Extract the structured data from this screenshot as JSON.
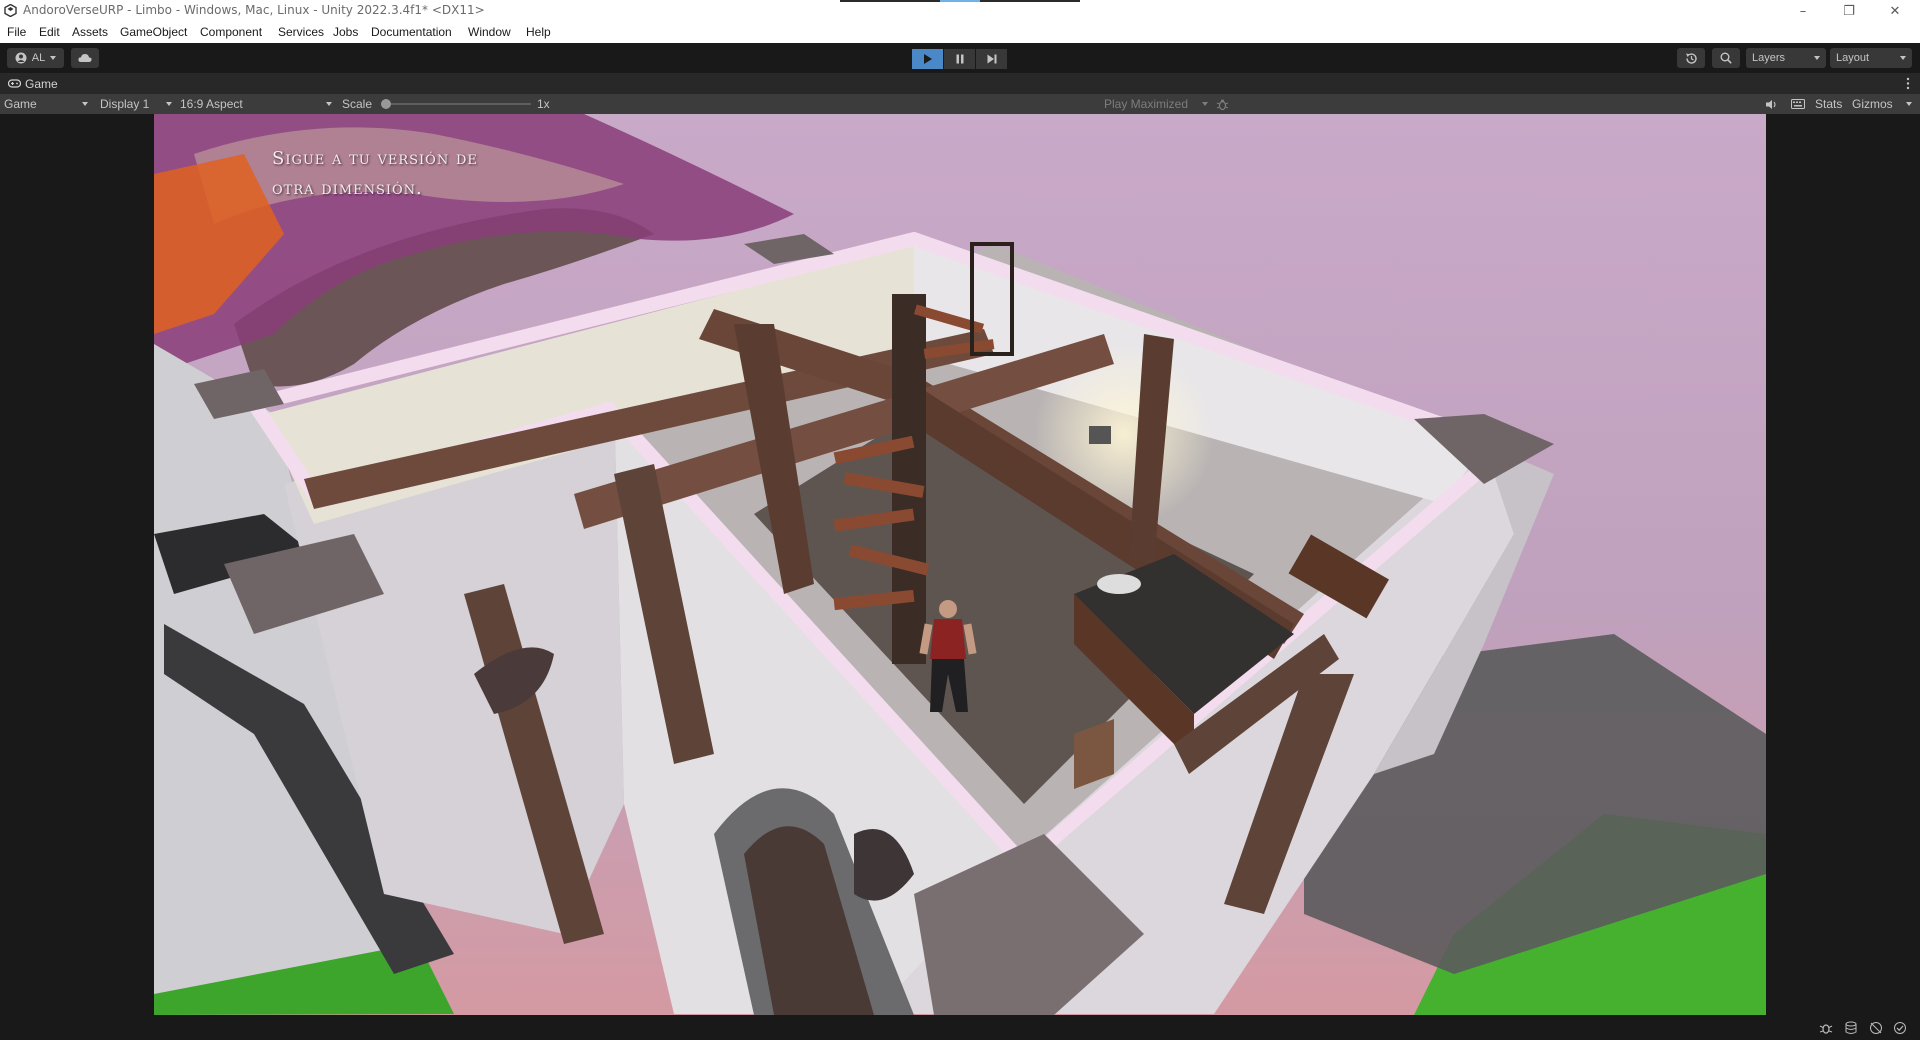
{
  "window": {
    "title": "AndoroVerseURP - Limbo - Windows, Mac, Linux - Unity 2022.3.4f1* <DX11>",
    "minimize": "–",
    "restore": "❐",
    "close": "✕"
  },
  "menu": {
    "items": [
      "File",
      "Edit",
      "Assets",
      "GameObject",
      "Component",
      "Services",
      "Jobs",
      "Documentation",
      "Window",
      "Help"
    ]
  },
  "toolbar": {
    "account_label": "AL",
    "layers_label": "Layers",
    "layout_label": "Layout",
    "play_active": true
  },
  "tab": {
    "label": "Game"
  },
  "gamebar": {
    "view_mode": "Game",
    "display": "Display 1",
    "aspect": "16:9 Aspect",
    "scale_label": "Scale",
    "scale_value": "1x",
    "scale_level": 0,
    "play_mode": "Play Maximized",
    "stats_label": "Stats",
    "gizmos_label": "Gizmos"
  },
  "game": {
    "subtitle_line1": "Sigue a tu versión de",
    "subtitle_line2": "otra dimensión."
  },
  "colors": {
    "accent_play": "#4a88c7",
    "editor_bg": "#191919",
    "toolbar_button": "#383838"
  }
}
